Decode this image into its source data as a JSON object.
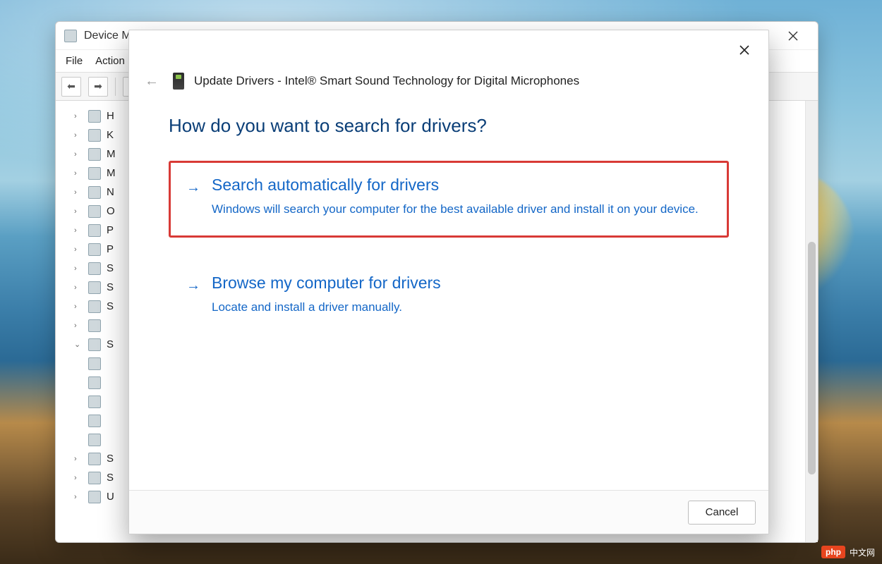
{
  "watermark": {
    "badge": "php",
    "text": "中文网"
  },
  "devmgr": {
    "title": "Device Manager",
    "menu": {
      "file": "File",
      "action": "Action"
    },
    "tree": [
      {
        "caret": "›",
        "icon": "hardware",
        "label": "H"
      },
      {
        "caret": "›",
        "icon": "keyboard",
        "label": "K"
      },
      {
        "caret": "›",
        "icon": "mouse",
        "label": "M"
      },
      {
        "caret": "›",
        "icon": "monitor",
        "label": "M"
      },
      {
        "caret": "›",
        "icon": "network",
        "label": "N"
      },
      {
        "caret": "›",
        "icon": "other",
        "label": "O"
      },
      {
        "caret": "›",
        "icon": "printer",
        "label": "P"
      },
      {
        "caret": "›",
        "icon": "processor",
        "label": "P"
      },
      {
        "caret": "›",
        "icon": "security",
        "label": "S"
      },
      {
        "caret": "›",
        "icon": "smartcard",
        "label": "S"
      },
      {
        "caret": "›",
        "icon": "software",
        "label": "S"
      },
      {
        "caret": "›",
        "icon": "device",
        "label": " "
      },
      {
        "caret": "⌄",
        "icon": "sound",
        "label": "S"
      },
      {
        "caret": " ",
        "icon": "sound-dev",
        "label": " "
      },
      {
        "caret": " ",
        "icon": "sound-dev",
        "label": " "
      },
      {
        "caret": " ",
        "icon": "sound-dev",
        "label": " "
      },
      {
        "caret": " ",
        "icon": "sound-dev",
        "label": " "
      },
      {
        "caret": " ",
        "icon": "sound-dev",
        "label": " "
      },
      {
        "caret": "›",
        "icon": "storage",
        "label": "S"
      },
      {
        "caret": "›",
        "icon": "system",
        "label": "S"
      },
      {
        "caret": "›",
        "icon": "usb",
        "label": "U"
      }
    ]
  },
  "dialog": {
    "title": "Update Drivers - Intel® Smart Sound Technology for Digital Microphones",
    "question": "How do you want to search for drivers?",
    "options": [
      {
        "title": "Search automatically for drivers",
        "desc": "Windows will search your computer for the best available driver and install it on your device.",
        "highlight": true
      },
      {
        "title": "Browse my computer for drivers",
        "desc": "Locate and install a driver manually.",
        "highlight": false
      }
    ],
    "cancel": "Cancel"
  }
}
